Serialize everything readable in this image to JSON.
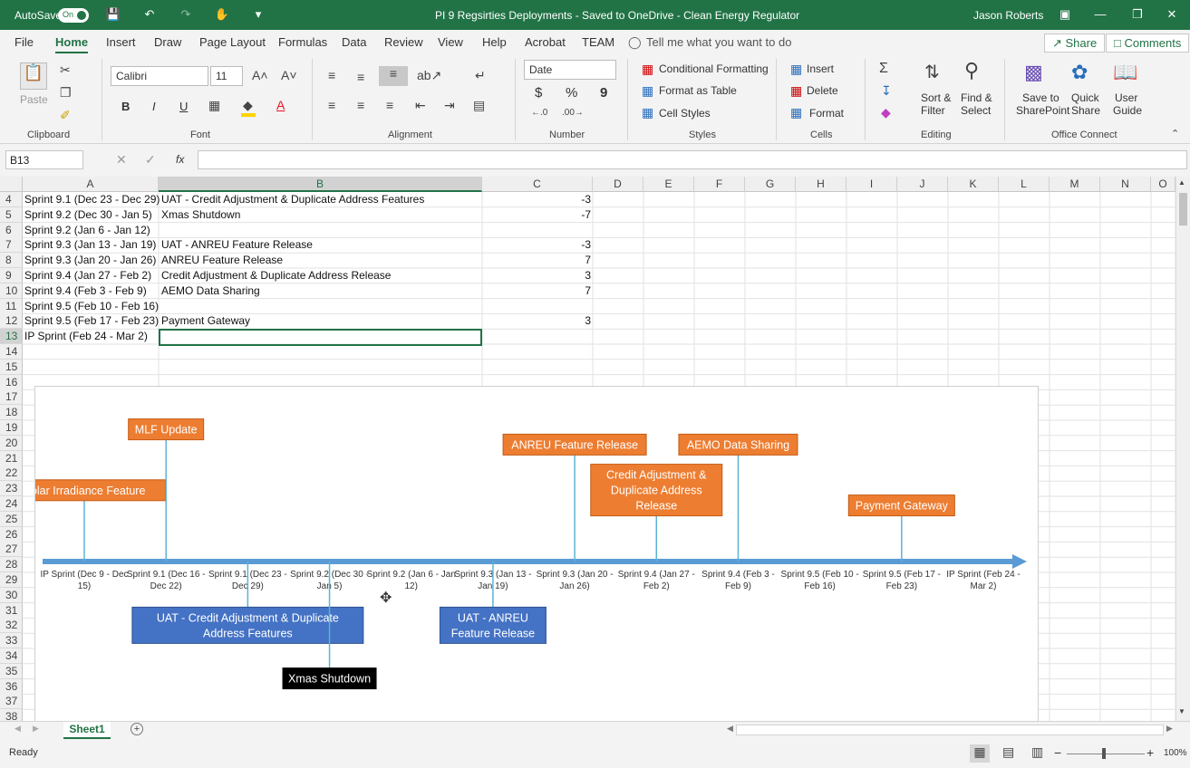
{
  "titlebar": {
    "autosave_label": "AutoSave",
    "autosave_state": "On",
    "doc_title": "PI 9 Regsirties Deployments  -  Saved to OneDrive - Clean Energy Regulator",
    "user": "Jason Roberts",
    "icons": [
      "save-icon",
      "undo-icon",
      "redo-icon",
      "touch-mode-icon",
      "customize-icon",
      "ribbon-display-icon",
      "minimize-icon",
      "restore-icon",
      "close-icon"
    ]
  },
  "menubar": {
    "tabs": [
      "File",
      "Home",
      "Insert",
      "Draw",
      "Page Layout",
      "Formulas",
      "Data",
      "Review",
      "View",
      "Help",
      "Acrobat",
      "TEAM"
    ],
    "active": "Home",
    "tell_me": "Tell me what you want to do",
    "share": "Share",
    "comments": "Comments"
  },
  "ribbon": {
    "clipboard": {
      "label": "Clipboard",
      "paste": "Paste"
    },
    "font": {
      "label": "Font",
      "font_name": "Calibri",
      "font_size": "11",
      "bold": "B",
      "italic": "I",
      "underline": "U",
      "fill_color": "#ffd400",
      "font_color": "#e81123"
    },
    "alignment": {
      "label": "Alignment"
    },
    "number": {
      "label": "Number",
      "format": "Date",
      "currency": "$",
      "percent": "%",
      "comma": "9"
    },
    "styles": {
      "label": "Styles",
      "conditional": "Conditional Formatting",
      "format_table": "Format as Table",
      "cell_styles": "Cell Styles"
    },
    "cells": {
      "label": "Cells",
      "insert": "Insert",
      "delete": "Delete",
      "format": "Format"
    },
    "editing": {
      "label": "Editing",
      "sort_filter": [
        "Sort &",
        "Filter"
      ],
      "find_select": [
        "Find &",
        "Select"
      ]
    },
    "office_connect": {
      "label": "Office Connect",
      "save_sharepoint": [
        "Save to",
        "SharePoint"
      ],
      "quick_share": [
        "Quick",
        "Share"
      ],
      "user_guide": [
        "User",
        "Guide"
      ]
    }
  },
  "formula_bar": {
    "name_box": "B13",
    "fx": "fx",
    "formula": ""
  },
  "grid": {
    "columns": [
      "A",
      "B",
      "C",
      "D",
      "E",
      "F",
      "G",
      "H",
      "I",
      "J",
      "K",
      "L",
      "M",
      "N",
      "O"
    ],
    "selected_column": "B",
    "row_numbers": [
      "4",
      "5",
      "6",
      "7",
      "8",
      "9",
      "10",
      "11",
      "12",
      "13",
      "14",
      "15",
      "16",
      "17",
      "18",
      "19",
      "20",
      "21",
      "22",
      "23",
      "24",
      "25",
      "26",
      "27",
      "28",
      "29",
      "30",
      "31",
      "32",
      "33",
      "34",
      "35",
      "36",
      "37",
      "38"
    ],
    "selected_row": "13",
    "rows": [
      {
        "a": "Sprint 9.1 (Dec 23 - Dec 29)",
        "b": "UAT - Credit Adjustment & Duplicate Address Features",
        "c": "-3"
      },
      {
        "a": "Sprint 9.2 (Dec 30 - Jan 5)",
        "b": "Xmas Shutdown",
        "c": "-7"
      },
      {
        "a": "Sprint 9.2 (Jan 6 - Jan 12)",
        "b": "",
        "c": ""
      },
      {
        "a": "Sprint 9.3 (Jan 13 - Jan 19)",
        "b": "UAT - ANREU Feature Release",
        "c": "-3"
      },
      {
        "a": "Sprint 9.3 (Jan 20 - Jan 26)",
        "b": "ANREU Feature Release",
        "c": "7"
      },
      {
        "a": "Sprint 9.4 (Jan 27 - Feb 2)",
        "b": "Credit Adjustment & Duplicate Address Release",
        "c": "3"
      },
      {
        "a": "Sprint 9.4 (Feb 3 - Feb 9)",
        "b": "AEMO Data Sharing",
        "c": "7"
      },
      {
        "a": "Sprint 9.5 (Feb 10 - Feb 16)",
        "b": "",
        "c": ""
      },
      {
        "a": "Sprint 9.5 (Feb 17 - Feb 23)",
        "b": "Payment Gateway",
        "c": "3"
      },
      {
        "a": "IP Sprint (Feb 24 - Mar 2)",
        "b": "",
        "c": ""
      }
    ]
  },
  "timeline": {
    "axis_labels": [
      [
        "IP Sprint (Dec 9 - Dec",
        "15)"
      ],
      [
        "Sprint 9.1 (Dec 16 -",
        "Dec 22)"
      ],
      [
        "Sprint 9.1 (Dec 23 -",
        "Dec 29)"
      ],
      [
        "Sprint 9.2 (Dec 30 -",
        "Jan 5)"
      ],
      [
        "Sprint 9.2 (Jan 6 - Jan",
        "12)"
      ],
      [
        "Sprint 9.3 (Jan 13 -",
        "Jan 19)"
      ],
      [
        "Sprint 9.3 (Jan 20 -",
        "Jan 26)"
      ],
      [
        "Sprint 9.4 (Jan 27 -",
        "Feb 2)"
      ],
      [
        "Sprint 9.4 (Feb 3 -",
        "Feb 9)"
      ],
      [
        "Sprint 9.5 (Feb 10 -",
        "Feb 16)"
      ],
      [
        "Sprint 9.5 (Feb 17 -",
        "Feb 23)"
      ],
      [
        "IP Sprint (Feb 24 -",
        "Mar 2)"
      ]
    ],
    "milestones": [
      {
        "idx": 0,
        "value": 4,
        "lines": [
          "Solar Irradiance Feature"
        ],
        "style": "orange"
      },
      {
        "idx": 1,
        "value": 8,
        "lines": [
          "MLF Update"
        ],
        "style": "orange"
      },
      {
        "idx": 2,
        "value": -3,
        "lines": [
          "UAT - Credit Adjustment & Duplicate",
          "Address Features"
        ],
        "style": "blue"
      },
      {
        "idx": 3,
        "value": -7,
        "lines": [
          "Xmas Shutdown"
        ],
        "style": "black"
      },
      {
        "idx": 5,
        "value": -3,
        "lines": [
          "UAT - ANREU",
          "Feature Release"
        ],
        "style": "blue"
      },
      {
        "idx": 6,
        "value": 7,
        "lines": [
          "ANREU Feature Release"
        ],
        "style": "orange"
      },
      {
        "idx": 7,
        "value": 3,
        "lines": [
          "Credit Adjustment &",
          "Duplicate Address",
          "Release"
        ],
        "style": "orange"
      },
      {
        "idx": 8,
        "value": 7,
        "lines": [
          "AEMO Data Sharing"
        ],
        "style": "orange"
      },
      {
        "idx": 10,
        "value": 3,
        "lines": [
          "Payment Gateway"
        ],
        "style": "orange"
      }
    ],
    "colors": {
      "axis": "#5b9bd5",
      "orange": "#ed7d31",
      "blue": "#4472c4",
      "black": "#000000",
      "connector": "#5bb4d5"
    }
  },
  "sheet_tabs": {
    "active": "Sheet1",
    "add": "+"
  },
  "status": {
    "ready": "Ready",
    "zoom": "100%"
  }
}
